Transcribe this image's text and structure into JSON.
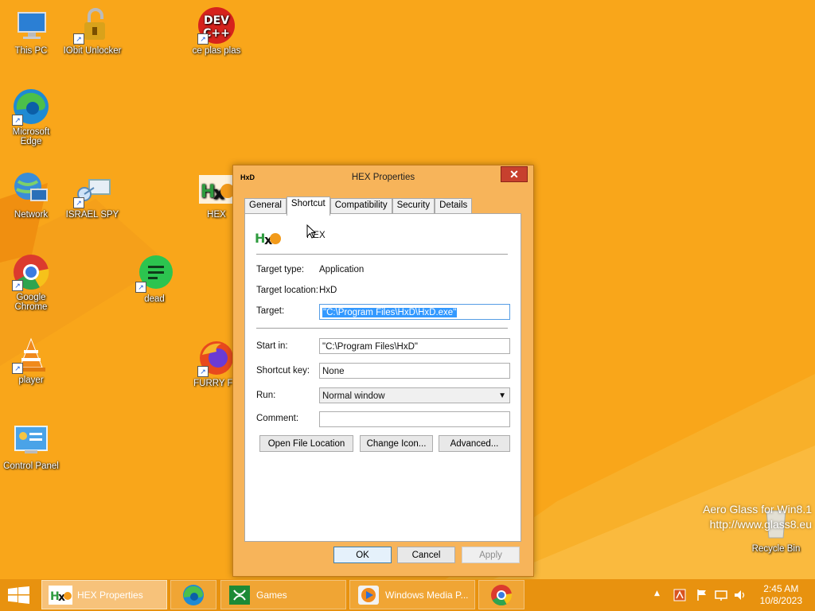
{
  "desktop": {
    "icons": [
      {
        "label": "This PC",
        "icon": "this-pc-icon"
      },
      {
        "label": "IObit Unlocker",
        "icon": "iobit-unlocker-icon"
      },
      {
        "label": "ce plas plas",
        "icon": "dev-cpp-icon"
      },
      {
        "label": "Microsoft Edge",
        "icon": "edge-icon"
      },
      {
        "label": "Network",
        "icon": "network-icon"
      },
      {
        "label": "ISRAEL SPY",
        "icon": "israel-spy-icon"
      },
      {
        "label": "HEX",
        "icon": "hxd-icon"
      },
      {
        "label": "Google Chrome",
        "icon": "chrome-icon"
      },
      {
        "label": "dead",
        "icon": "spotify-icon"
      },
      {
        "label": "player",
        "icon": "vlc-icon"
      },
      {
        "label": "FURRY FU",
        "icon": "firefox-icon"
      },
      {
        "label": "Control Panel",
        "icon": "control-panel-icon"
      },
      {
        "label": "Recycle Bin",
        "icon": "recycle-bin-icon"
      }
    ],
    "dev_icon_text": "DEV\nC++",
    "watermark_line1": "Aero Glass for Win8.1",
    "watermark_line2": "http://www.glass8.eu"
  },
  "dialog": {
    "title": "HEX Properties",
    "close_label": "✕",
    "tabs": [
      "General",
      "Shortcut",
      "Compatibility",
      "Security",
      "Details"
    ],
    "active_tab": "Shortcut",
    "shortcut_name": "HEX",
    "target_type_label": "Target type:",
    "target_type_value": "Application",
    "target_location_label": "Target location:",
    "target_location_value": "HxD",
    "target_label": "Target:",
    "target_value": "\"C:\\Program Files\\HxD\\HxD.exe\"",
    "start_in_label": "Start in:",
    "start_in_value": "\"C:\\Program Files\\HxD\"",
    "shortcut_key_label": "Shortcut key:",
    "shortcut_key_value": "None",
    "run_label": "Run:",
    "run_value": "Normal window",
    "comment_label": "Comment:",
    "comment_value": "",
    "open_file_location": "Open File Location",
    "change_icon": "Change Icon...",
    "advanced": "Advanced...",
    "ok": "OK",
    "cancel": "Cancel",
    "apply": "Apply"
  },
  "taskbar": {
    "items": [
      {
        "label": "HEX Properties",
        "icon": "hxd-icon"
      },
      {
        "label": "",
        "icon": "edge-icon"
      },
      {
        "label": "Games",
        "icon": "xbox-icon"
      },
      {
        "label": "Windows Media P...",
        "icon": "media-player-icon"
      },
      {
        "label": "",
        "icon": "chrome-icon"
      }
    ],
    "time": "2:45 AM",
    "date": "10/8/2023"
  },
  "colors": {
    "desktop_bg": "#f9a61a",
    "taskbar_bg": "#e8920f",
    "selection": "#3399ff",
    "close_button": "#c7402e"
  }
}
